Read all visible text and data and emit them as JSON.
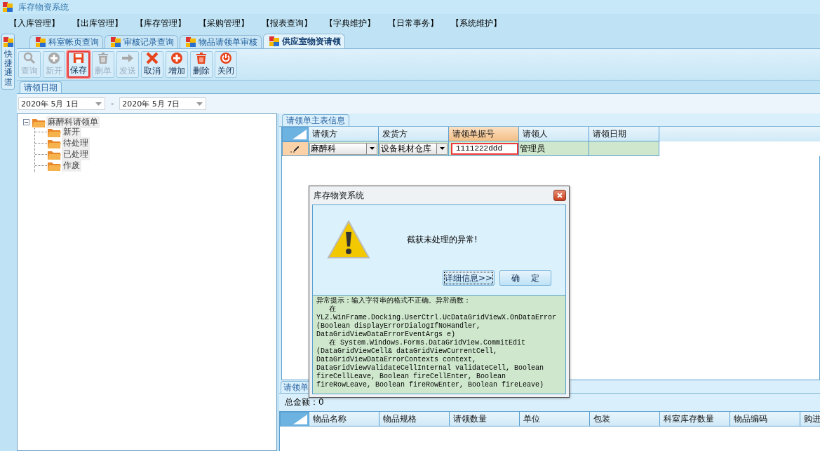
{
  "window": {
    "title": "库存物资系统"
  },
  "menu": [
    "【入库管理】",
    "【出库管理】",
    "【库存管理】",
    "【采购管理】",
    "【报表查询】",
    "【字典维护】",
    "【日常事务】",
    "【系统维护】"
  ],
  "quick_bar": {
    "label": "快捷通道"
  },
  "tabs": [
    {
      "label": "科室帐页查询",
      "selected": false
    },
    {
      "label": "审核记录查询",
      "selected": false
    },
    {
      "label": "物品请领单审核",
      "selected": false
    },
    {
      "label": "供应室物资请领",
      "selected": true
    }
  ],
  "toolbar": [
    {
      "label": "查询",
      "kind": "search",
      "disabled": true,
      "highlighted": false
    },
    {
      "label": "新开",
      "kind": "plus",
      "disabled": true,
      "highlighted": false
    },
    {
      "label": "保存",
      "kind": "save",
      "disabled": false,
      "highlighted": true
    },
    {
      "label": "删单",
      "kind": "trash",
      "disabled": true,
      "highlighted": false
    },
    {
      "label": "发送",
      "kind": "send",
      "disabled": true,
      "highlighted": false
    },
    {
      "label": "取消",
      "kind": "cancel",
      "disabled": false,
      "highlighted": false
    },
    {
      "label": "增加",
      "kind": "plus",
      "disabled": false,
      "highlighted": false
    },
    {
      "label": "删除",
      "kind": "trash",
      "disabled": false,
      "highlighted": false
    },
    {
      "label": "关闭",
      "kind": "power",
      "disabled": false,
      "highlighted": false
    }
  ],
  "date_filter": {
    "title": "请领日期",
    "from": "2020年 5月 1日",
    "separator": "-",
    "to": "2020年 5月 7日"
  },
  "tree": {
    "label": "麻醉科请领单",
    "expanded": true,
    "children": [
      {
        "label": "新开"
      },
      {
        "label": "待处理"
      },
      {
        "label": "已处理"
      },
      {
        "label": "作废"
      }
    ]
  },
  "master": {
    "title": "请领单主表信息",
    "columns": [
      {
        "label": "请领方",
        "current": false
      },
      {
        "label": "发货方",
        "current": false
      },
      {
        "label": "请领单据号",
        "current": true
      },
      {
        "label": "请领人",
        "current": false
      },
      {
        "label": "请领日期",
        "current": false
      }
    ],
    "rows": [
      {
        "editing": true,
        "cells": [
          {
            "kind": "combo",
            "value": "麻醉科"
          },
          {
            "kind": "combo",
            "value": "设备耗材仓库"
          },
          {
            "kind": "edit",
            "value": "1111222ddd",
            "highlighted": true
          },
          {
            "kind": "text",
            "value": "管理员"
          },
          {
            "kind": "text"
          }
        ]
      }
    ]
  },
  "detail": {
    "title": "请领单",
    "total": "总金额：0",
    "columns": [
      "物品名称",
      "物品规格",
      "请领数量",
      "单位",
      "包装",
      "科室库存数量",
      "物品编码",
      "购进"
    ]
  },
  "dialog": {
    "title": "库存物资系统",
    "message": "截获未处理的异常!",
    "buttons": [
      {
        "label": "详细信息>>",
        "focused": true
      },
      {
        "label": "确    定",
        "focused": false
      }
    ],
    "details": [
      "异常提示：输入字符串的格式不正确。异常函数：",
      "   在",
      "YLZ.WinFrame.Docking.UserCtrl.UcDataGridViewX.OnDataError",
      "(Boolean displayErrorDialogIfNoHandler,",
      "DataGridViewDataErrorEventArgs e)",
      "   在 System.Windows.Forms.DataGridView.CommitEdit",
      "(DataGridViewCell& dataGridViewCurrentCell,",
      "DataGridViewDataErrorContexts context,",
      "DataGridViewValidateCellInternal validateCell, Boolean",
      "fireCellLeave, Boolean fireCellEnter, Boolean",
      "fireRowLeave, Boolean fireRowEnter, Boolean fireLeave)"
    ]
  }
}
